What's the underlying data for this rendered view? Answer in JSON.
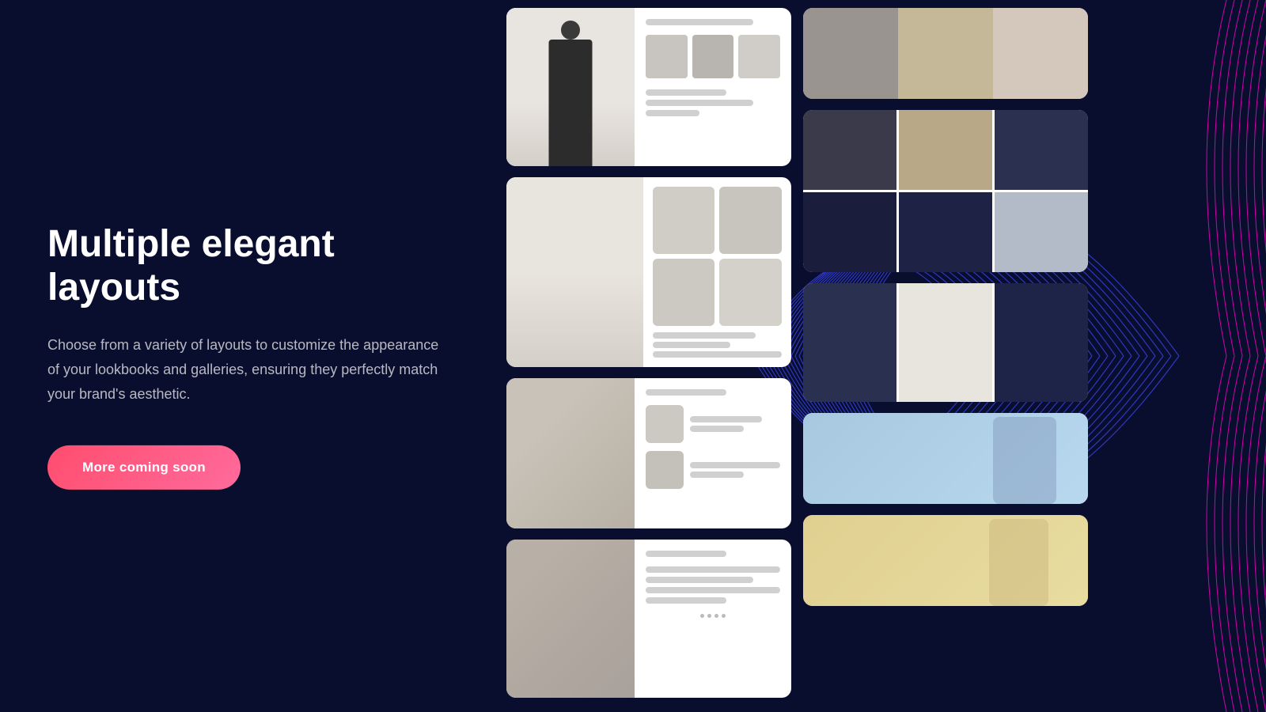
{
  "page": {
    "title": "Multiple elegant layouts",
    "description": "Choose from a variety of layouts to customize the appearance of your lookbooks and galleries, ensuring they perfectly match your brand's aesthetic.",
    "cta_label": "More coming soon",
    "background_color": "#0a0e2e"
  },
  "colors": {
    "bg": "#0a0e2e",
    "title": "#ffffff",
    "description": "rgba(255,255,255,0.7)",
    "cta_bg": "linear-gradient(135deg, #ff4d6d, #ff6b9d)",
    "cta_text": "#ffffff",
    "wave_blue": "#3d4aff",
    "wave_pink": "#ff00cc"
  },
  "wave": {
    "label": "decorative wave background"
  }
}
